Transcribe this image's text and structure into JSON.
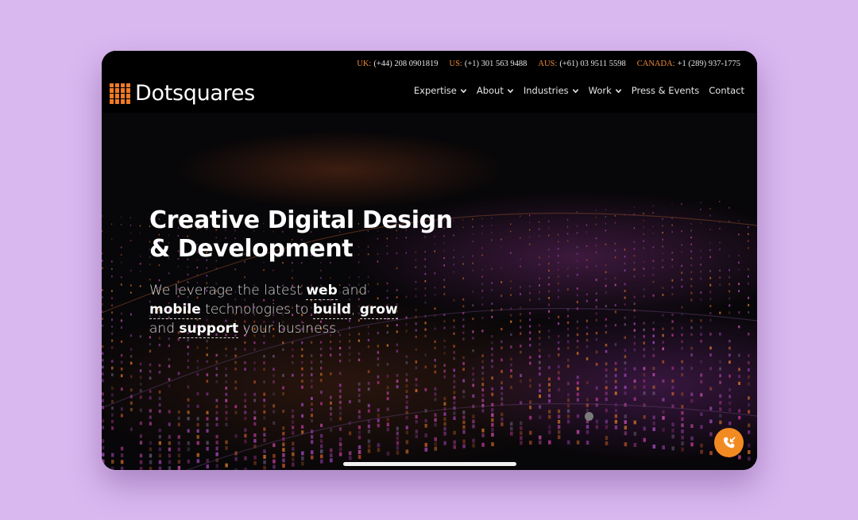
{
  "header": {
    "phones": [
      {
        "country": "UK:",
        "number": "(+44) 208 0901819"
      },
      {
        "country": "US:",
        "number": "(+1) 301 563 9488"
      },
      {
        "country": "AUS:",
        "number": "(+61) 03 9511 5598"
      },
      {
        "country": "CANADA:",
        "number": "+1 (289) 937-1775"
      }
    ],
    "logo_text": "Dotsquares",
    "nav": [
      {
        "label": "Expertise",
        "has_dropdown": true
      },
      {
        "label": "About",
        "has_dropdown": true
      },
      {
        "label": "Industries",
        "has_dropdown": true
      },
      {
        "label": "Work",
        "has_dropdown": true
      },
      {
        "label": "Press & Events",
        "has_dropdown": false
      },
      {
        "label": "Contact",
        "has_dropdown": false
      }
    ]
  },
  "hero": {
    "headline_line1": "Creative Digital Design",
    "headline_line2": "& Development",
    "sub": {
      "t1": "We leverage the latest ",
      "w1": "web",
      "t2": " and ",
      "w2": "mobile",
      "t3": " technologies to ",
      "w3": "build",
      "t4": ", ",
      "w4": "grow",
      "t5": " and ",
      "w5": "support",
      "t6": " your business."
    }
  },
  "colors": {
    "accent": "#f07a26",
    "background": "#d9b7ef",
    "call_button": "#f28a22"
  },
  "icons": {
    "logo": "grid-logo-icon",
    "chevron": "chevron-down-icon",
    "call": "phone-call-icon"
  }
}
